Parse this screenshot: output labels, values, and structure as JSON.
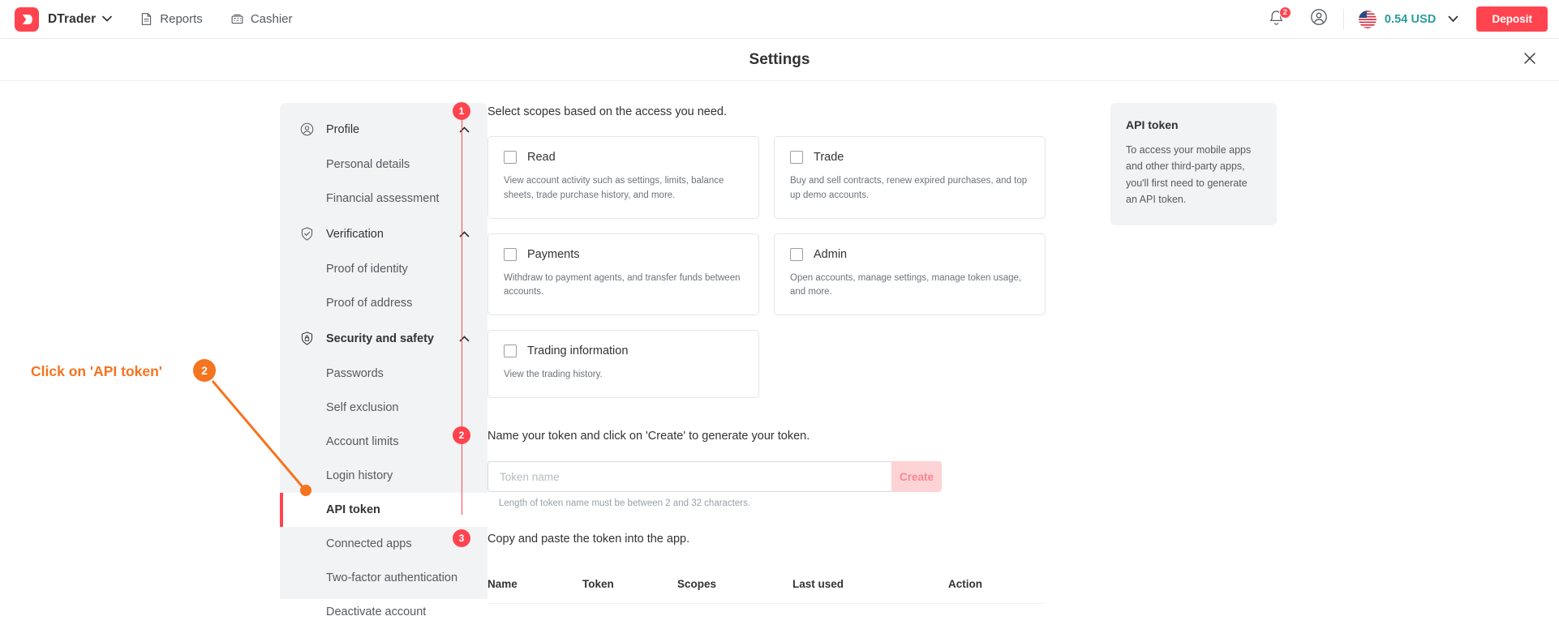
{
  "topbar": {
    "brand_name": "DTrader",
    "brand_logo_icon": "dtrader-logo-icon",
    "brand_chevron_icon": "chevron-down-icon",
    "nav": [
      {
        "label": "Reports",
        "icon": "reports-icon"
      },
      {
        "label": "Cashier",
        "icon": "cashier-icon"
      }
    ],
    "notifications": {
      "icon": "bell-icon",
      "count": "2"
    },
    "account_icon": "account-circle-icon",
    "flag_icon": "us-flag-icon",
    "balance": "0.54 USD",
    "balance_color": "#2a9d9d",
    "balance_chevron_icon": "chevron-down-icon",
    "deposit_label": "Deposit",
    "accent_color": "#ff444f"
  },
  "modal": {
    "title": "Settings",
    "close_icon": "close-icon"
  },
  "sidebar": {
    "groups": [
      {
        "label": "Profile",
        "icon": "person-circle-icon",
        "chevron": "chevron-up-icon",
        "active": false,
        "items": [
          {
            "label": "Personal details",
            "selected": false
          },
          {
            "label": "Financial assessment",
            "selected": false
          }
        ]
      },
      {
        "label": "Verification",
        "icon": "shield-check-icon",
        "chevron": "chevron-up-icon",
        "active": false,
        "items": [
          {
            "label": "Proof of identity",
            "selected": false
          },
          {
            "label": "Proof of address",
            "selected": false
          }
        ]
      },
      {
        "label": "Security and safety",
        "icon": "shield-lock-icon",
        "chevron": "chevron-up-icon",
        "active": true,
        "items": [
          {
            "label": "Passwords",
            "selected": false
          },
          {
            "label": "Self exclusion",
            "selected": false
          },
          {
            "label": "Account limits",
            "selected": false
          },
          {
            "label": "Login history",
            "selected": false
          },
          {
            "label": "API token",
            "selected": true
          },
          {
            "label": "Connected apps",
            "selected": false
          },
          {
            "label": "Two-factor authentication",
            "selected": false
          },
          {
            "label": "Deactivate account",
            "selected": false
          }
        ]
      }
    ]
  },
  "annotation": {
    "text": "Click on 'API token'",
    "badge": "2",
    "color": "#f5741f"
  },
  "main": {
    "steps": [
      {
        "number": "1",
        "text": "Select scopes based on the access you need."
      },
      {
        "number": "2",
        "text": "Name your token and click on 'Create' to generate your token."
      },
      {
        "number": "3",
        "text": "Copy and paste the token into the app."
      }
    ],
    "scopes": [
      {
        "title": "Read",
        "desc": "View account activity such as settings, limits, balance sheets, trade purchase history, and more.",
        "checked": false
      },
      {
        "title": "Trade",
        "desc": "Buy and sell contracts, renew expired purchases, and top up demo accounts.",
        "checked": false
      },
      {
        "title": "Payments",
        "desc": "Withdraw to payment agents, and transfer funds between accounts.",
        "checked": false
      },
      {
        "title": "Admin",
        "desc": "Open accounts, manage settings, manage token usage, and more.",
        "checked": false
      },
      {
        "title": "Trading information",
        "desc": "View the trading history.",
        "checked": false
      }
    ],
    "token_form": {
      "placeholder": "Token name",
      "value": "",
      "create_label": "Create",
      "hint": "Length of token name must be between 2 and 32 characters."
    },
    "table": {
      "columns": [
        "Name",
        "Token",
        "Scopes",
        "Last used",
        "Action"
      ],
      "rows": []
    }
  },
  "info_panel": {
    "title": "API token",
    "body": "To access your mobile apps and other third-party apps, you'll first need to generate an API token."
  }
}
